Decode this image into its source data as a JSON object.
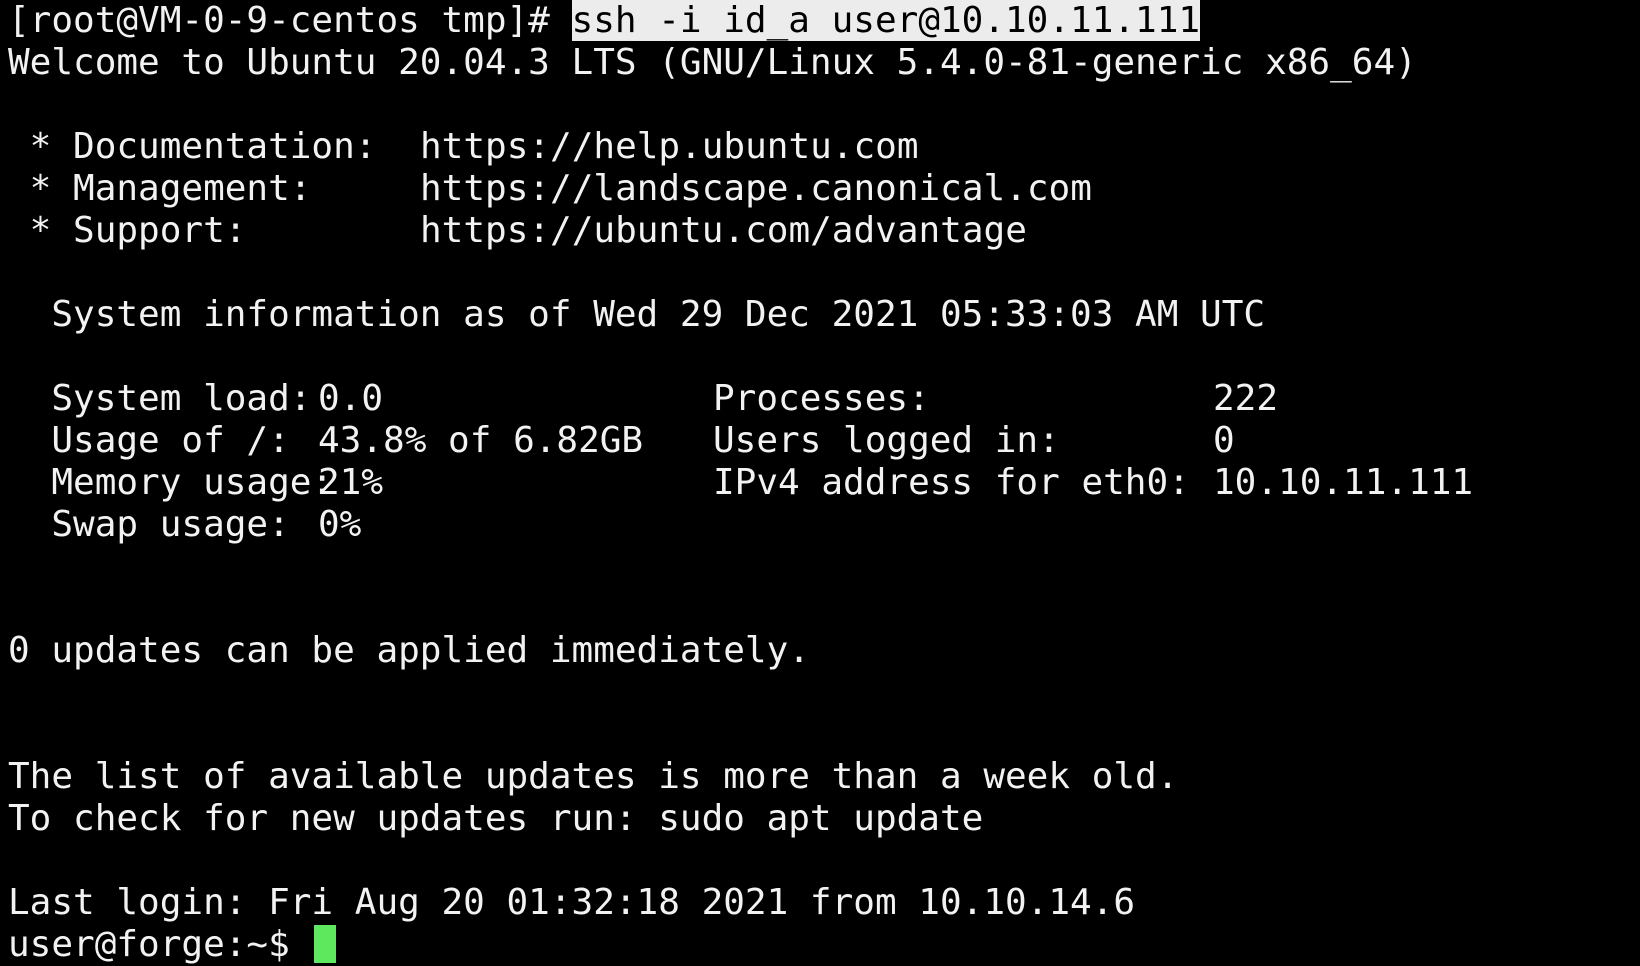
{
  "prompt_line": {
    "prompt": "[root@VM-0-9-centos tmp]# ",
    "command": "ssh -i id_a user@10.10.11.111"
  },
  "welcome": "Welcome to Ubuntu 20.04.3 LTS (GNU/Linux 5.4.0-81-generic x86_64)",
  "motd_links": [
    {
      "label": " * Documentation:",
      "url": "https://help.ubuntu.com"
    },
    {
      "label": " * Management:",
      "url": "https://landscape.canonical.com"
    },
    {
      "label": " * Support:",
      "url": "https://ubuntu.com/advantage"
    }
  ],
  "sysinfo_header": "  System information as of Wed 29 Dec 2021 05:33:03 AM UTC",
  "sysinfo": [
    {
      "k1": "  System load:",
      "v1": "0.0",
      "k2": "Processes:",
      "v2": "222"
    },
    {
      "k1": "  Usage of /:",
      "v1": "43.8% of 6.82GB",
      "k2": "Users logged in:",
      "v2": "0"
    },
    {
      "k1": "  Memory usage:",
      "v1": "21%",
      "k2": "IPv4 address for eth0:",
      "v2": "10.10.11.111"
    },
    {
      "k1": "  Swap usage:",
      "v1": "0%",
      "k2": "",
      "v2": ""
    }
  ],
  "updates_msg": "0 updates can be applied immediately.",
  "stale_list_msg": "The list of available updates is more than a week old.",
  "check_updates_msg": "To check for new updates run: sudo apt update",
  "last_login": "Last login: Fri Aug 20 01:32:18 2021 from 10.10.14.6",
  "shell_prompt": "user@forge:~$ ",
  "colors": {
    "background": "#000000",
    "foreground": "#f2f2f2",
    "selection": "#ececec",
    "cursor": "#5ee85e"
  }
}
